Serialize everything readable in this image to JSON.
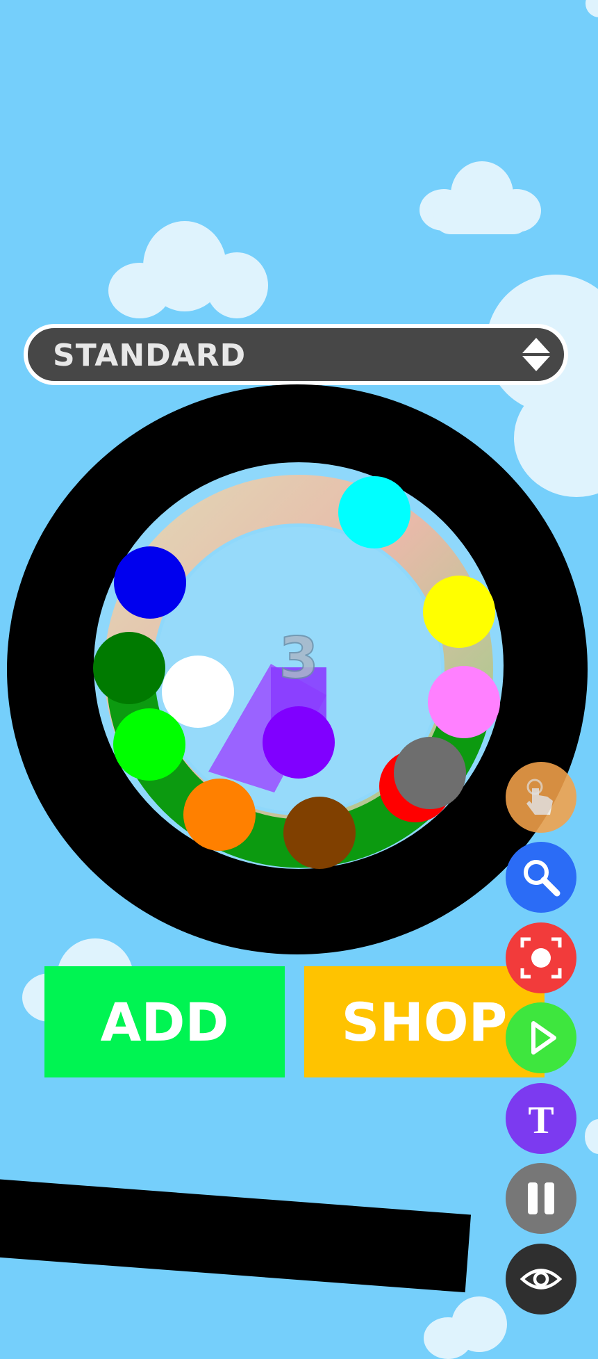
{
  "mode_selector": {
    "label": "STANDARD",
    "icon": "up-down-arrows-icon"
  },
  "game": {
    "countdown": "3",
    "balls": [
      "cyan",
      "blue",
      "yellow",
      "dark-green",
      "white",
      "pink",
      "green",
      "purple",
      "red",
      "gray",
      "orange",
      "brown"
    ],
    "colors": {
      "sky": "#75cffb",
      "ring": "#000000",
      "cyan": "#00ffff",
      "blue": "#0000ee",
      "yellow": "#ffff00",
      "dark_green": "#007a00",
      "white": "#ffffff",
      "pink": "#ff80ff",
      "green": "#00ff00",
      "purple": "#8000ff",
      "red": "#ff0000",
      "gray": "#6e6e6e",
      "orange": "#ff8000",
      "brown": "#804000"
    }
  },
  "buttons": {
    "add": "ADD",
    "shop": "SHOP"
  },
  "side_toolbar": [
    {
      "name": "touch",
      "icon": "tap-hand-icon",
      "color": "#f4a24a"
    },
    {
      "name": "zoom",
      "icon": "magnifier-icon",
      "color": "#2b6cf6"
    },
    {
      "name": "focus",
      "icon": "screenshot-target-icon",
      "color": "#f23b3b"
    },
    {
      "name": "play",
      "icon": "play-icon",
      "color": "#3ee63e"
    },
    {
      "name": "text",
      "icon": "text-t-icon",
      "color": "#7c3af0"
    },
    {
      "name": "pause",
      "icon": "pause-icon",
      "color": "#777777"
    },
    {
      "name": "view",
      "icon": "eye-icon",
      "color": "#2f2f2f"
    }
  ]
}
